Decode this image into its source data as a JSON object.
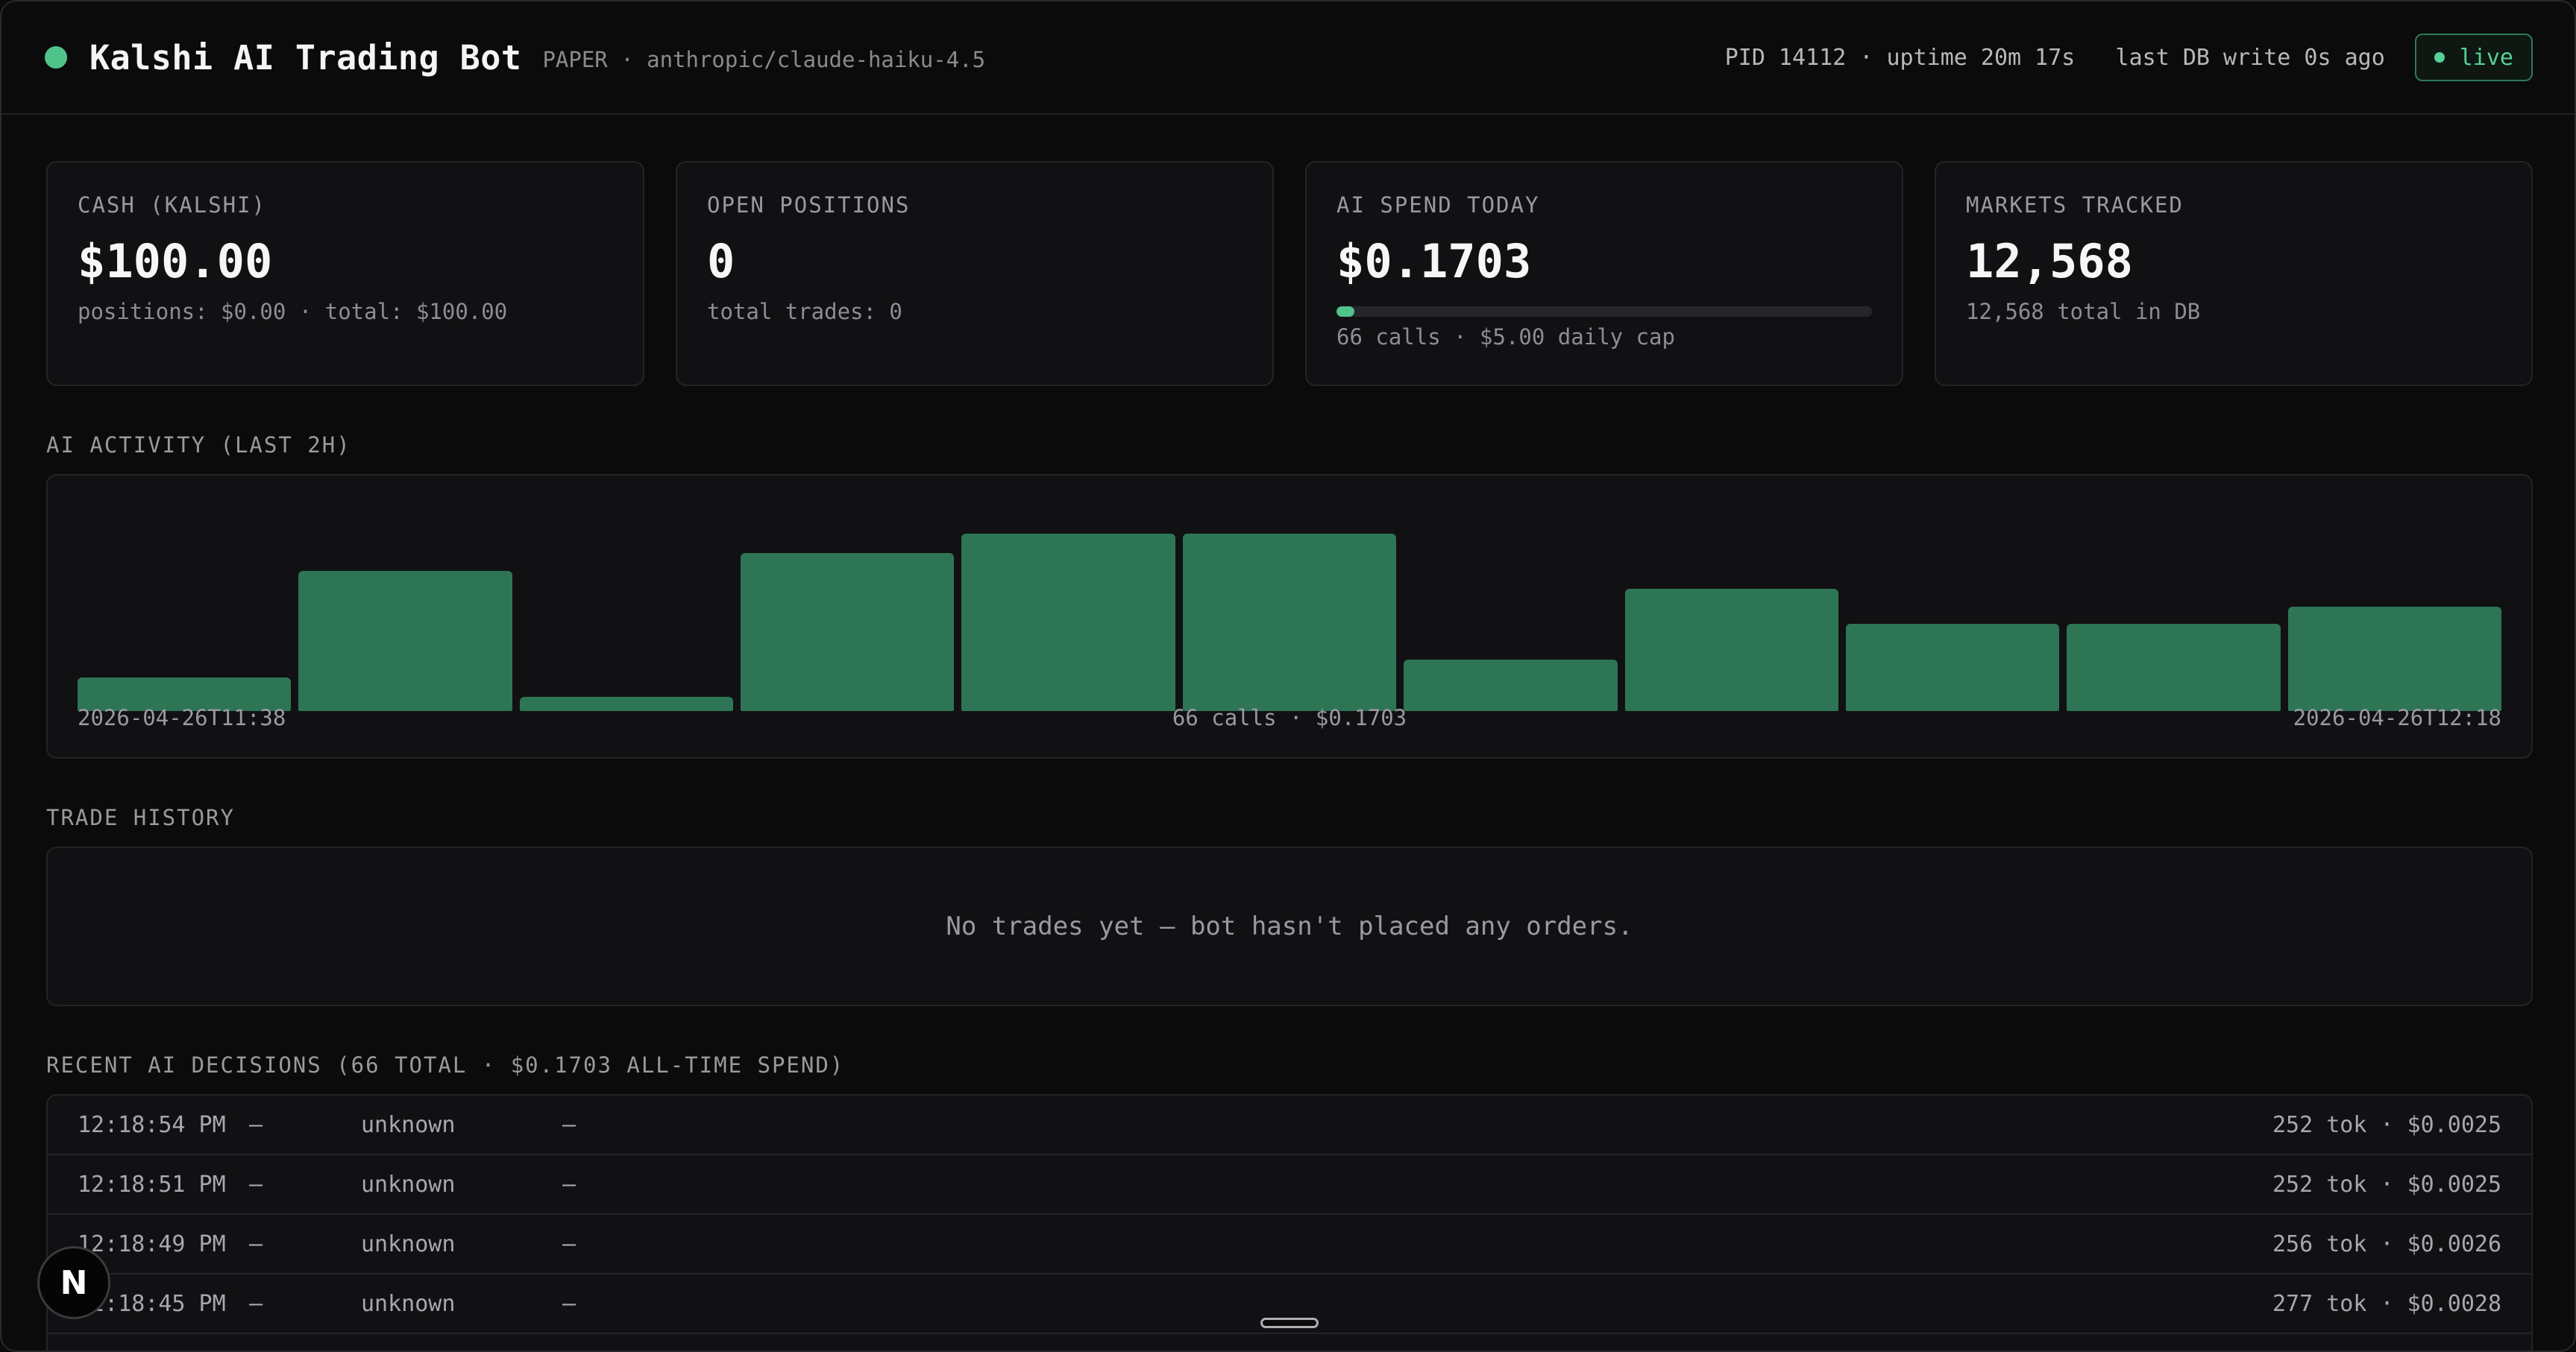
{
  "header": {
    "title": "Kalshi AI Trading Bot",
    "subtitle": "PAPER · anthropic/claude-haiku-4.5",
    "meta": "PID 14112 · uptime 20m 17s   last DB write 0s ago",
    "live_label": "live",
    "accent": "#4fc38a"
  },
  "cards": [
    {
      "label": "CASH (KALSHI)",
      "value": "$100.00",
      "sub": "positions: $0.00 · total: $100.00"
    },
    {
      "label": "OPEN POSITIONS",
      "value": "0",
      "sub": "total trades: 0"
    },
    {
      "label": "AI SPEND TODAY",
      "value": "$0.1703",
      "sub": "66 calls · $5.00 daily cap",
      "progress_fraction": 0.034
    },
    {
      "label": "MARKETS TRACKED",
      "value": "12,568",
      "sub": "12,568 total in DB"
    }
  ],
  "activity": {
    "section_label": "AI ACTIVITY (LAST 2H)",
    "start_label": "2026-04-26T11:38",
    "center_label": "66 calls · $0.1703",
    "end_label": "2026-04-26T12:18",
    "bar_color": "#2e7556",
    "relative_values": [
      0.19,
      0.79,
      0.08,
      0.89,
      1.0,
      1.0,
      0.29,
      0.69,
      0.49,
      0.49,
      0.59
    ]
  },
  "trades": {
    "section_label": "TRADE HISTORY",
    "empty_text": "No trades yet — bot hasn't placed any orders."
  },
  "decisions": {
    "section_label": "RECENT AI DECISIONS (66 TOTAL · $0.1703 ALL-TIME SPEND)",
    "rows": [
      {
        "time": "12:18:54 PM",
        "dash1": "—",
        "kind": "unknown",
        "dash2": "—",
        "cost": "252 tok · $0.0025"
      },
      {
        "time": "12:18:51 PM",
        "dash1": "—",
        "kind": "unknown",
        "dash2": "—",
        "cost": "252 tok · $0.0025"
      },
      {
        "time": "12:18:49 PM",
        "dash1": "—",
        "kind": "unknown",
        "dash2": "—",
        "cost": "256 tok · $0.0026"
      },
      {
        "time": "12:18:45 PM",
        "dash1": "—",
        "kind": "unknown",
        "dash2": "—",
        "cost": "277 tok · $0.0028"
      }
    ]
  },
  "dev_badge": {
    "label": "N"
  }
}
